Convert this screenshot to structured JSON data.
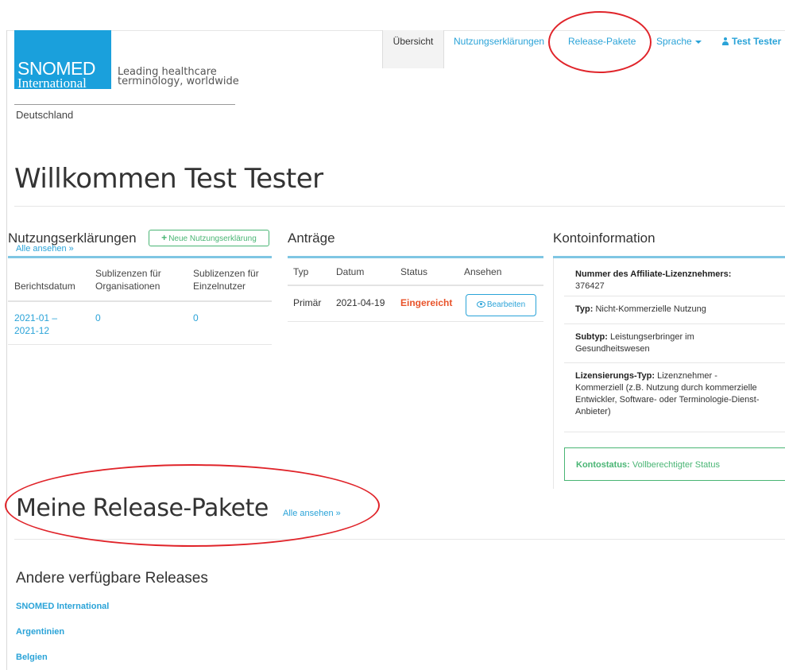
{
  "header": {
    "logo_line1": "SNOMED",
    "logo_line2": "International",
    "tagline_line1": "Leading healthcare",
    "tagline_line2": "terminology, worldwide",
    "country": "Deutschland"
  },
  "nav": {
    "overview": "Übersicht",
    "usage": "Nutzungserklärungen",
    "releases": "Release-Pakete",
    "language": "Sprache",
    "user": "Test Tester"
  },
  "welcome": "Willkommen Test Tester",
  "usage_section": {
    "title": "Nutzungserklärungen",
    "new_button": "Neue Nutzungserklärung",
    "see_all": "Alle ansehen »",
    "headers": [
      "Berichtsdatum",
      "Sublizenzen für Organisationen",
      "Sublizenzen für Einzelnutzer"
    ],
    "rows": [
      {
        "period": "2021-01 – 2021-12",
        "orgs": "0",
        "individuals": "0"
      }
    ]
  },
  "applications": {
    "title": "Anträge",
    "headers": [
      "Typ",
      "Datum",
      "Status",
      "Ansehen"
    ],
    "rows": [
      {
        "type": "Primär",
        "date": "2021-04-19",
        "status": "Eingereicht",
        "action": "Bearbeiten"
      }
    ]
  },
  "account": {
    "title": "Kontoinformation",
    "affiliate_label": "Nummer des Affiliate-Lizenznehmers",
    "affiliate_value": "376427",
    "type_label": "Typ",
    "type_value": "Nicht-Kommerzielle Nutzung",
    "subtype_label": "Subtyp",
    "subtype_value": "Leistungserbringer im Gesundheitswesen",
    "licensing_label": "Lizensierungs-Typ",
    "licensing_value": "Lizenznehmer - Kommerziell (z.B. Nutzung durch kommerzielle Entwickler, Software- oder Terminologie-Dienst-Anbieter)",
    "status_label": "Kontostatus",
    "status_value": "Vollberechtigter Status"
  },
  "releases": {
    "title": "Meine Release-Pakete",
    "see_all": "Alle ansehen »",
    "other_title": "Andere verfügbare Releases",
    "links": [
      "SNOMED International",
      "Argentinien",
      "Belgien"
    ]
  },
  "colors": {
    "link": "#2aa3d8",
    "brand": "#1aa0dc",
    "success": "#49b574",
    "danger": "#e8532a",
    "annotation": "#e0242a"
  }
}
